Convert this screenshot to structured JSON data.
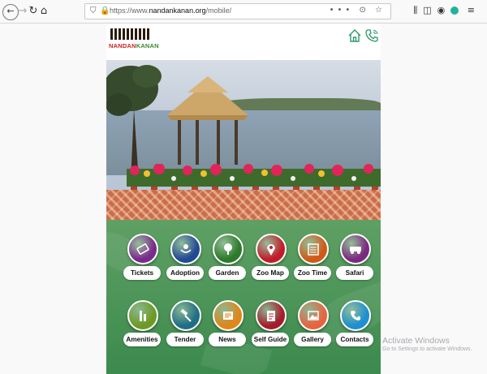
{
  "browser": {
    "url_prefix": "https://www.",
    "url_domain": "nandankanan.org",
    "url_path": "/mobile/",
    "page_actions": "••• ⊙ ☆"
  },
  "header": {
    "logo_text_part1": "NANDAN",
    "logo_text_part2": "KANAN"
  },
  "tiles": [
    {
      "label": "Tickets",
      "color": "#7a2a8c",
      "icon": "ticket-icon"
    },
    {
      "label": "Adoption",
      "color": "#234a94",
      "icon": "adoption-icon"
    },
    {
      "label": "Garden",
      "color": "#2d7a2a",
      "icon": "garden-icon"
    },
    {
      "label": "Zoo Map",
      "color": "#c21c2b",
      "icon": "map-pin-icon"
    },
    {
      "label": "Zoo Time",
      "color": "#d05a18",
      "icon": "calendar-icon"
    },
    {
      "label": "Safari",
      "color": "#7c2a80",
      "icon": "safari-vehicle-icon"
    },
    {
      "label": "Amenities",
      "color": "#6d9a24",
      "icon": "amenities-icon"
    },
    {
      "label": "Tender",
      "color": "#1f6e86",
      "icon": "gavel-icon"
    },
    {
      "label": "News",
      "color": "#e0861a",
      "icon": "newspaper-icon"
    },
    {
      "label": "Self Guide",
      "color": "#a51d2b",
      "icon": "guide-book-icon"
    },
    {
      "label": "Gallery",
      "color": "#e8633f",
      "icon": "gallery-icon"
    },
    {
      "label": "Contacts",
      "color": "#1e8fd1",
      "icon": "phone-icon"
    }
  ],
  "os_overlay": {
    "title": "Activate Windows",
    "subtitle": "Go to Settings to activate Windows."
  }
}
